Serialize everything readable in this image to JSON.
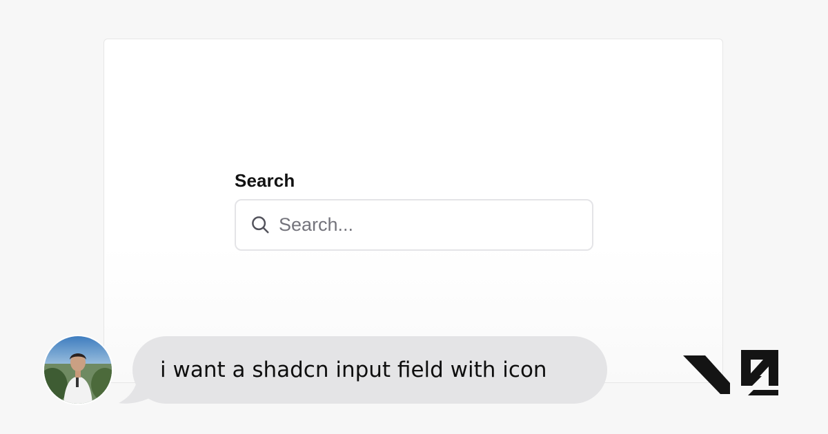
{
  "form": {
    "label": "Search",
    "input_placeholder": "Search...",
    "input_value": "",
    "icon": "search-icon"
  },
  "chat": {
    "message": "i want a shadcn input field with icon",
    "avatar_icon": "user-avatar"
  },
  "brand": {
    "logo_text": "v0",
    "logo_color": "#141414"
  },
  "colors": {
    "page_bg": "#f7f7f7",
    "card_bg": "#ffffff",
    "bubble_bg": "#e4e4e6",
    "input_border": "#e4e4e7",
    "placeholder": "#74747c"
  }
}
